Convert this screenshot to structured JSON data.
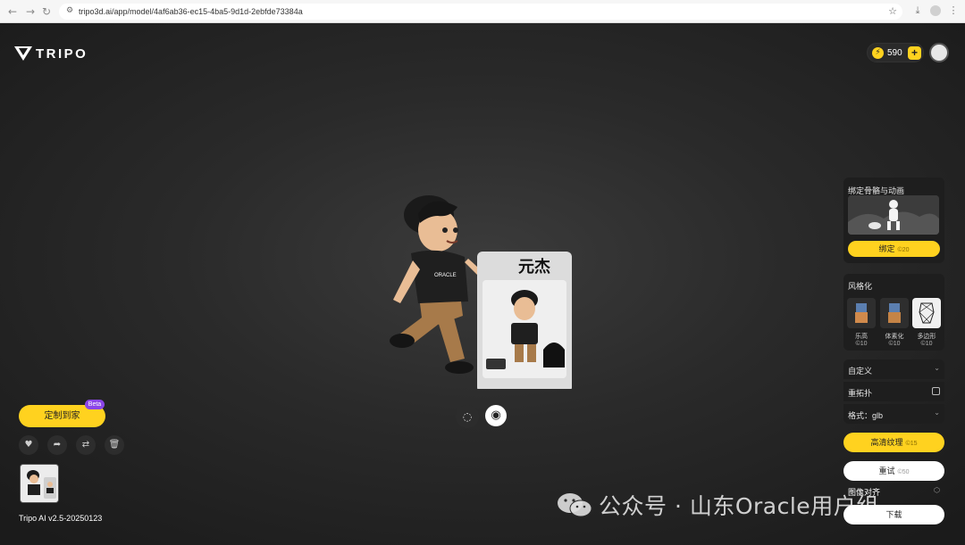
{
  "browser": {
    "url": "tripo3d.ai/app/model/4af6ab36-ec15-4ba5-9d1d-2ebfde73384a",
    "nav_icons": [
      "back-arrow-icon",
      "forward-arrow-icon",
      "reload-icon"
    ]
  },
  "header": {
    "logo_text": "TRIPO",
    "credits": "590",
    "plus_label": "+",
    "accent_color": "#ffd21f"
  },
  "model": {
    "box_text": "元杰"
  },
  "left": {
    "customize_label": "定制到家",
    "beta_label": "Beta",
    "actions": [
      "heart-icon",
      "share-icon",
      "swap-icon",
      "trash-icon"
    ],
    "version": "Tripo AI v2.5-20250123"
  },
  "right": {
    "rig": {
      "title": "绑定骨骼与动画",
      "button_label": "绑定",
      "button_cost": "20"
    },
    "stylize": {
      "title": "风格化",
      "options": [
        {
          "label": "乐高",
          "cost": "10"
        },
        {
          "label": "体素化",
          "cost": "10"
        },
        {
          "label": "多边形",
          "cost": "10"
        }
      ]
    },
    "custom_label": "自定义",
    "retopo_label": "重拓扑",
    "format_label": "格式：glb",
    "hd_texture_label": "高清纹理",
    "hd_texture_cost": "15",
    "retry_label": "重试",
    "retry_cost": "50",
    "align_label": "图像对齐",
    "download_label": "下载"
  },
  "watermark": {
    "text": "公众号 · 山东Oracle用户组"
  }
}
